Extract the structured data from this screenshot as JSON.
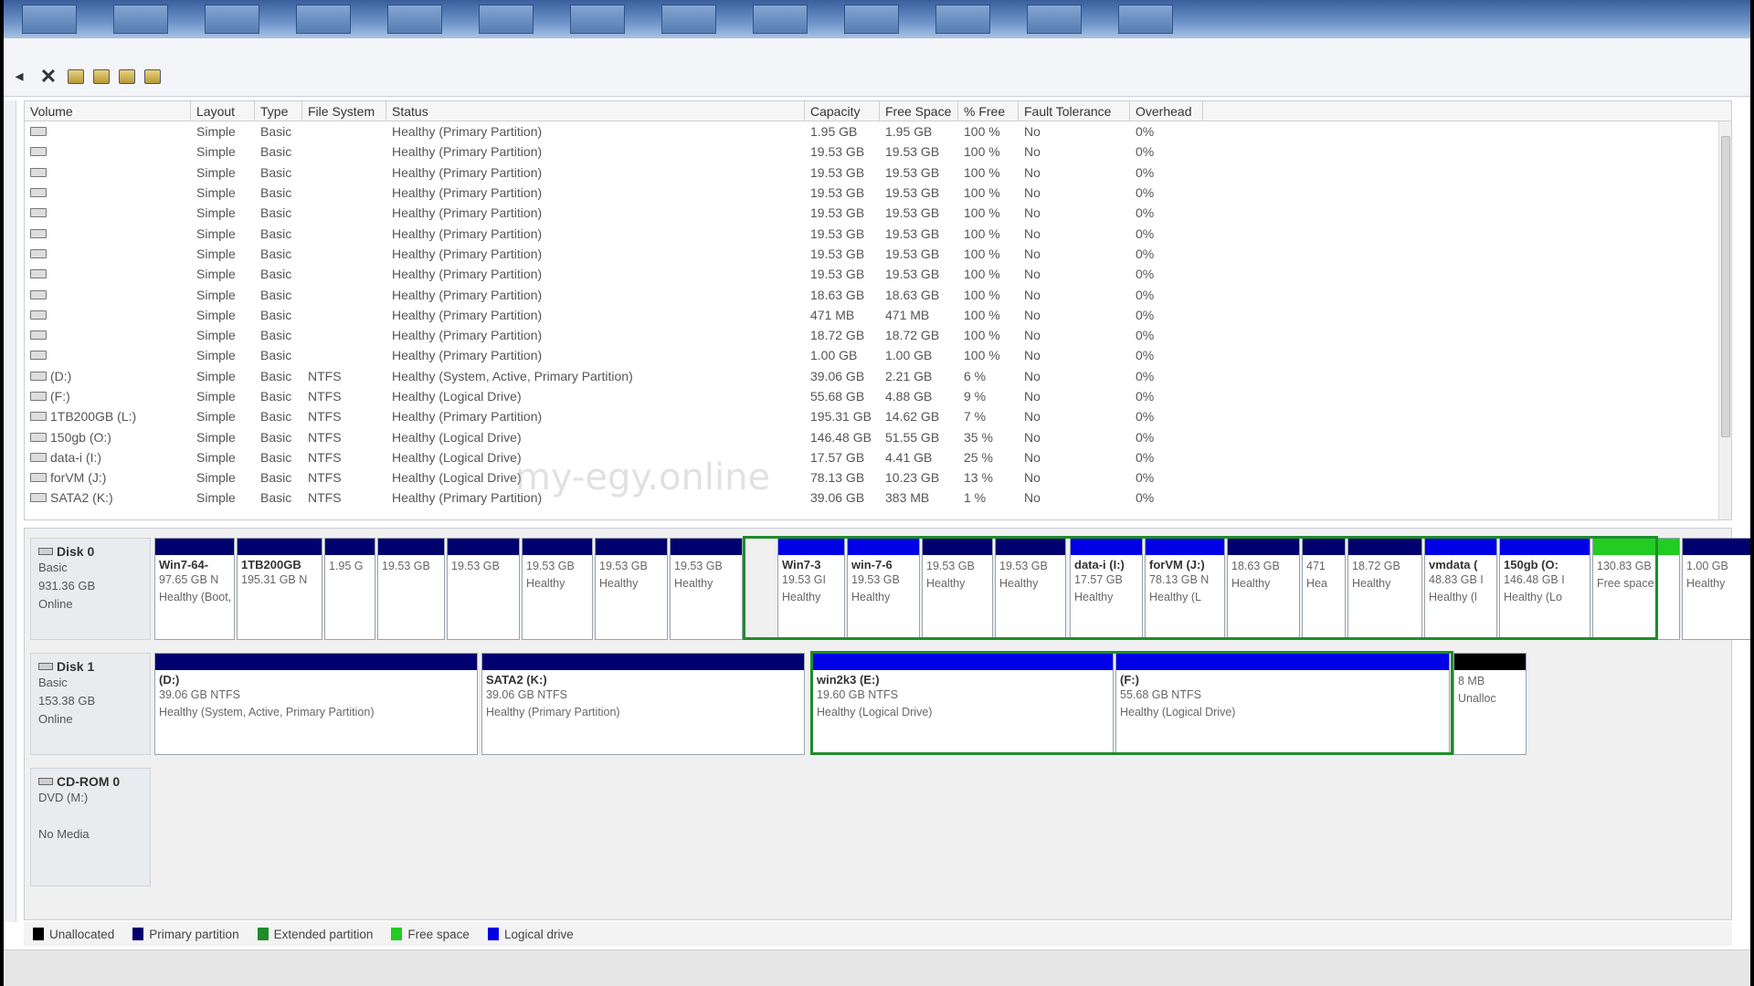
{
  "columns": [
    "Volume",
    "Layout",
    "Type",
    "File System",
    "Status",
    "Capacity",
    "Free Space",
    "% Free",
    "Fault Tolerance",
    "Overhead"
  ],
  "volumes": [
    {
      "name": "",
      "layout": "Simple",
      "type": "Basic",
      "fs": "",
      "status": "Healthy (Primary Partition)",
      "capacity": "1.95 GB",
      "free": "1.95 GB",
      "pct": "100 %",
      "fault": "No",
      "overhead": "0%"
    },
    {
      "name": "",
      "layout": "Simple",
      "type": "Basic",
      "fs": "",
      "status": "Healthy (Primary Partition)",
      "capacity": "19.53 GB",
      "free": "19.53 GB",
      "pct": "100 %",
      "fault": "No",
      "overhead": "0%"
    },
    {
      "name": "",
      "layout": "Simple",
      "type": "Basic",
      "fs": "",
      "status": "Healthy (Primary Partition)",
      "capacity": "19.53 GB",
      "free": "19.53 GB",
      "pct": "100 %",
      "fault": "No",
      "overhead": "0%"
    },
    {
      "name": "",
      "layout": "Simple",
      "type": "Basic",
      "fs": "",
      "status": "Healthy (Primary Partition)",
      "capacity": "19.53 GB",
      "free": "19.53 GB",
      "pct": "100 %",
      "fault": "No",
      "overhead": "0%"
    },
    {
      "name": "",
      "layout": "Simple",
      "type": "Basic",
      "fs": "",
      "status": "Healthy (Primary Partition)",
      "capacity": "19.53 GB",
      "free": "19.53 GB",
      "pct": "100 %",
      "fault": "No",
      "overhead": "0%"
    },
    {
      "name": "",
      "layout": "Simple",
      "type": "Basic",
      "fs": "",
      "status": "Healthy (Primary Partition)",
      "capacity": "19.53 GB",
      "free": "19.53 GB",
      "pct": "100 %",
      "fault": "No",
      "overhead": "0%"
    },
    {
      "name": "",
      "layout": "Simple",
      "type": "Basic",
      "fs": "",
      "status": "Healthy (Primary Partition)",
      "capacity": "19.53 GB",
      "free": "19.53 GB",
      "pct": "100 %",
      "fault": "No",
      "overhead": "0%"
    },
    {
      "name": "",
      "layout": "Simple",
      "type": "Basic",
      "fs": "",
      "status": "Healthy (Primary Partition)",
      "capacity": "19.53 GB",
      "free": "19.53 GB",
      "pct": "100 %",
      "fault": "No",
      "overhead": "0%"
    },
    {
      "name": "",
      "layout": "Simple",
      "type": "Basic",
      "fs": "",
      "status": "Healthy (Primary Partition)",
      "capacity": "18.63 GB",
      "free": "18.63 GB",
      "pct": "100 %",
      "fault": "No",
      "overhead": "0%"
    },
    {
      "name": "",
      "layout": "Simple",
      "type": "Basic",
      "fs": "",
      "status": "Healthy (Primary Partition)",
      "capacity": "471 MB",
      "free": "471 MB",
      "pct": "100 %",
      "fault": "No",
      "overhead": "0%"
    },
    {
      "name": "",
      "layout": "Simple",
      "type": "Basic",
      "fs": "",
      "status": "Healthy (Primary Partition)",
      "capacity": "18.72 GB",
      "free": "18.72 GB",
      "pct": "100 %",
      "fault": "No",
      "overhead": "0%"
    },
    {
      "name": "",
      "layout": "Simple",
      "type": "Basic",
      "fs": "",
      "status": "Healthy (Primary Partition)",
      "capacity": "1.00 GB",
      "free": "1.00 GB",
      "pct": "100 %",
      "fault": "No",
      "overhead": "0%"
    },
    {
      "name": "(D:)",
      "layout": "Simple",
      "type": "Basic",
      "fs": "NTFS",
      "status": "Healthy (System, Active, Primary Partition)",
      "capacity": "39.06 GB",
      "free": "2.21 GB",
      "pct": "6 %",
      "fault": "No",
      "overhead": "0%"
    },
    {
      "name": "(F:)",
      "layout": "Simple",
      "type": "Basic",
      "fs": "NTFS",
      "status": "Healthy (Logical Drive)",
      "capacity": "55.68 GB",
      "free": "4.88 GB",
      "pct": "9 %",
      "fault": "No",
      "overhead": "0%"
    },
    {
      "name": "1TB200GB (L:)",
      "layout": "Simple",
      "type": "Basic",
      "fs": "NTFS",
      "status": "Healthy (Primary Partition)",
      "capacity": "195.31 GB",
      "free": "14.62 GB",
      "pct": "7 %",
      "fault": "No",
      "overhead": "0%"
    },
    {
      "name": "150gb (O:)",
      "layout": "Simple",
      "type": "Basic",
      "fs": "NTFS",
      "status": "Healthy (Logical Drive)",
      "capacity": "146.48 GB",
      "free": "51.55 GB",
      "pct": "35 %",
      "fault": "No",
      "overhead": "0%"
    },
    {
      "name": "data-i (I:)",
      "layout": "Simple",
      "type": "Basic",
      "fs": "NTFS",
      "status": "Healthy (Logical Drive)",
      "capacity": "17.57 GB",
      "free": "4.41 GB",
      "pct": "25 %",
      "fault": "No",
      "overhead": "0%"
    },
    {
      "name": "forVM (J:)",
      "layout": "Simple",
      "type": "Basic",
      "fs": "NTFS",
      "status": "Healthy (Logical Drive)",
      "capacity": "78.13 GB",
      "free": "10.23 GB",
      "pct": "13 %",
      "fault": "No",
      "overhead": "0%"
    },
    {
      "name": "SATA2 (K:)",
      "layout": "Simple",
      "type": "Basic",
      "fs": "NTFS",
      "status": "Healthy (Primary Partition)",
      "capacity": "39.06 GB",
      "free": "383 MB",
      "pct": "1 %",
      "fault": "No",
      "overhead": "0%"
    }
  ],
  "disks": [
    {
      "name": "Disk 0",
      "type": "Basic",
      "size": "931.36 GB",
      "state": "Online",
      "partitions": [
        {
          "name": "Win7-64-",
          "size": "97.65 GB N",
          "status": "Healthy (Boot, Page File, Active, Crash Dump, Primary Partition)",
          "color": "#00006e"
        },
        {
          "name": "1TB200GB",
          "size": "195.31 GB N",
          "status": "",
          "color": "#00006e"
        },
        {
          "name": "",
          "size": "1.95 G",
          "status": "",
          "color": "#00006e"
        },
        {
          "name": "",
          "size": "19.53 GB",
          "status": "",
          "color": "#00006e"
        },
        {
          "name": "",
          "size": "19.53 GB",
          "status": "",
          "color": "#00006e"
        },
        {
          "name": "",
          "size": "19.53 GB",
          "status": "Healthy",
          "color": "#00006e"
        },
        {
          "name": "",
          "size": "19.53 GB",
          "status": "Healthy",
          "color": "#00006e"
        },
        {
          "name": "",
          "size": "19.53 GB",
          "status": "Healthy",
          "color": "#00006e"
        },
        {
          "name": "Win7-3",
          "size": "19.53 GI",
          "status": "Healthy",
          "color": "#0000e6"
        },
        {
          "name": "win-7-6",
          "size": "19.53 GB",
          "status": "Healthy",
          "color": "#0000e6"
        },
        {
          "name": "",
          "size": "19.53 GB",
          "status": "Healthy",
          "color": "#00006e"
        },
        {
          "name": "",
          "size": "19.53 GB",
          "status": "Healthy",
          "color": "#00006e"
        },
        {
          "name": "data-i (I:)",
          "size": "17.57 GB",
          "status": "Healthy",
          "color": "#0000e6"
        },
        {
          "name": "forVM (J:)",
          "size": "78.13 GB N",
          "status": "Healthy (L",
          "color": "#0000e6"
        },
        {
          "name": "",
          "size": "18.63 GB",
          "status": "Healthy",
          "color": "#00006e"
        },
        {
          "name": "",
          "size": "471",
          "status": "Hea",
          "color": "#00006e"
        },
        {
          "name": "",
          "size": "18.72 GB",
          "status": "Healthy",
          "color": "#00006e"
        },
        {
          "name": "vmdata (",
          "size": "48.83 GB I",
          "status": "Healthy (l",
          "color": "#0000e6"
        },
        {
          "name": "150gb (O:",
          "size": "146.48 GB I",
          "status": "Healthy (Lo",
          "color": "#0000e6"
        },
        {
          "name": "",
          "size": "130.83 GB",
          "status": "Free space",
          "color": "#22cc22"
        },
        {
          "name": "",
          "size": "1.00 GB",
          "status": "Healthy",
          "color": "#00006e"
        }
      ]
    },
    {
      "name": "Disk 1",
      "type": "Basic",
      "size": "153.38 GB",
      "state": "Online",
      "partitions": [
        {
          "name": "(D:)",
          "size": "39.06 GB NTFS",
          "status": "Healthy (System, Active, Primary Partition)",
          "color": "#00006e"
        },
        {
          "name": "SATA2 (K:)",
          "size": "39.06 GB NTFS",
          "status": "Healthy (Primary Partition)",
          "color": "#00006e"
        },
        {
          "name": "win2k3 (E:)",
          "size": "19.60 GB NTFS",
          "status": "Healthy (Logical Drive)",
          "color": "#0000e6"
        },
        {
          "name": "(F:)",
          "size": "55.68 GB NTFS",
          "status": "Healthy (Logical Drive)",
          "color": "#0000e6"
        },
        {
          "name": "",
          "size": "8 MB",
          "status": "Unalloc",
          "color": "#000000"
        }
      ]
    }
  ],
  "cdrom": {
    "name": "CD-ROM 0",
    "type": "DVD (M:)",
    "state": "No Media"
  },
  "legend": [
    {
      "label": "Unallocated",
      "color": "#000000"
    },
    {
      "label": "Primary partition",
      "color": "#00006e"
    },
    {
      "label": "Extended partition",
      "color": "#1f8c2b"
    },
    {
      "label": "Free space",
      "color": "#22cc22"
    },
    {
      "label": "Logical drive",
      "color": "#0000e6"
    }
  ],
  "watermark": "my-egy.online"
}
